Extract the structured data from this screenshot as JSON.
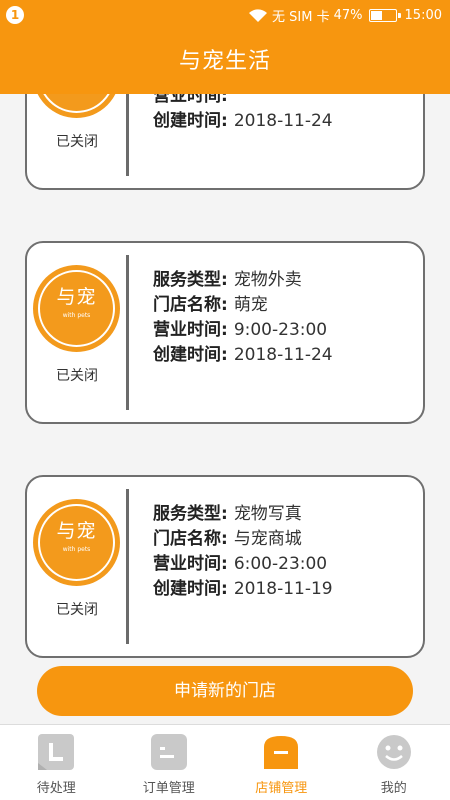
{
  "status_bar": {
    "badge": "1",
    "carrier_text": "无 SIM 卡",
    "battery_percent": "47%",
    "battery_level": 0.47,
    "time": "15:00"
  },
  "header": {
    "title": "与宠生活"
  },
  "labels": {
    "service_type": "服务类型:",
    "store_name": "门店名称:",
    "hours": "营业时间:",
    "created": "创建时间:"
  },
  "logo": {
    "text": "与宠",
    "subtext": "with pets"
  },
  "stores": [
    {
      "status": "已关闭",
      "service_type": "",
      "store_name": "",
      "hours": "",
      "created": "2018-11-24"
    },
    {
      "status": "已关闭",
      "service_type": "宠物外卖",
      "store_name": "萌宠",
      "hours": "9:00-23:00",
      "created": "2018-11-24"
    },
    {
      "status": "已关闭",
      "service_type": "宠物写真",
      "store_name": "与宠商城",
      "hours": "6:00-23:00",
      "created": "2018-11-19"
    }
  ],
  "apply_button": "申请新的门店",
  "tabs": [
    {
      "label": "待处理",
      "icon": "pending-icon",
      "active": false
    },
    {
      "label": "订单管理",
      "icon": "order-icon",
      "active": false
    },
    {
      "label": "店铺管理",
      "icon": "store-icon",
      "active": true
    },
    {
      "label": "我的",
      "icon": "profile-icon",
      "active": false
    }
  ],
  "colors": {
    "accent": "#f7960f",
    "inactive_icon": "#c9c9c9",
    "card_border": "#6f6f6f"
  }
}
